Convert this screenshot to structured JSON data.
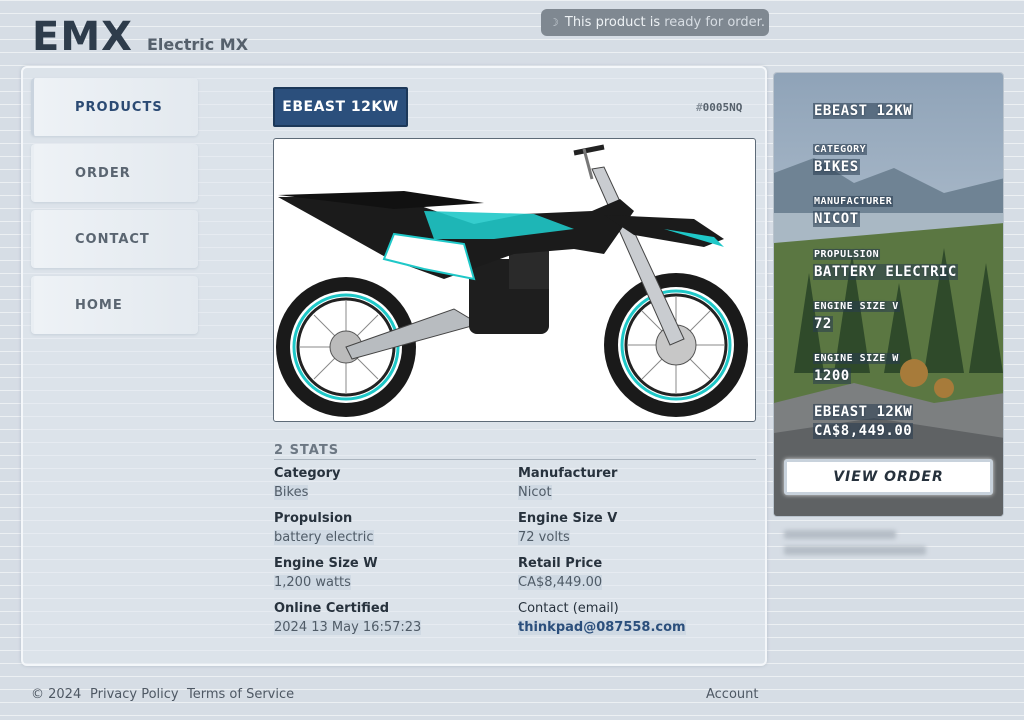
{
  "brand": {
    "logo": "EMX",
    "subtitle": "Electric MX"
  },
  "toast": {
    "prefix": "This product is",
    "highlight": "ready for order."
  },
  "nav": {
    "items": [
      {
        "label": "PRODUCTS",
        "active": true
      },
      {
        "label": "ORDER",
        "active": false
      },
      {
        "label": "CONTACT",
        "active": false
      },
      {
        "label": "HOME",
        "active": false
      }
    ]
  },
  "product": {
    "title": "EBEAST 12KW",
    "sku_hash": "#",
    "sku": "0005NQ",
    "image_alt": "Nicot EBEAST electric dirt bike, black with teal graphics"
  },
  "stats": {
    "heading": "2 STATS",
    "items": [
      {
        "key": "Category",
        "value": "Bikes"
      },
      {
        "key": "Manufacturer",
        "value": "Nicot"
      },
      {
        "key": "Propulsion",
        "value": "battery electric"
      },
      {
        "key": "Engine Size V",
        "value": "72 volts"
      },
      {
        "key": "Engine Size W",
        "value": "1,200 watts"
      },
      {
        "key": "Retail Price",
        "value": "CA$8,449.00"
      },
      {
        "key": "Online Certified",
        "value": "2024 13 May 16:57:23"
      },
      {
        "key": "Contact (email)",
        "value": "thinkpad@087558.com"
      }
    ]
  },
  "side": {
    "title": "EBEAST 12KW",
    "fields": [
      {
        "label": "CATEGORY",
        "value": "BIKES"
      },
      {
        "label": "MANUFACTURER",
        "value": "NICOT"
      },
      {
        "label": "PROPULSION",
        "value": "BATTERY ELECTRIC"
      },
      {
        "label": "ENGINE SIZE V",
        "value": "72"
      },
      {
        "label": "ENGINE SIZE W",
        "value": "1200"
      }
    ],
    "bottom_title": "EBEAST 12KW",
    "bottom_price": "CA$8,449.00",
    "button": "VIEW ORDER"
  },
  "footer": {
    "copyright": "© 2024",
    "privacy": "Privacy Policy",
    "terms": "Terms of Service",
    "account": "Account"
  },
  "colors": {
    "accent": "#2b4f7c",
    "bike_teal": "#1fc8c8"
  }
}
